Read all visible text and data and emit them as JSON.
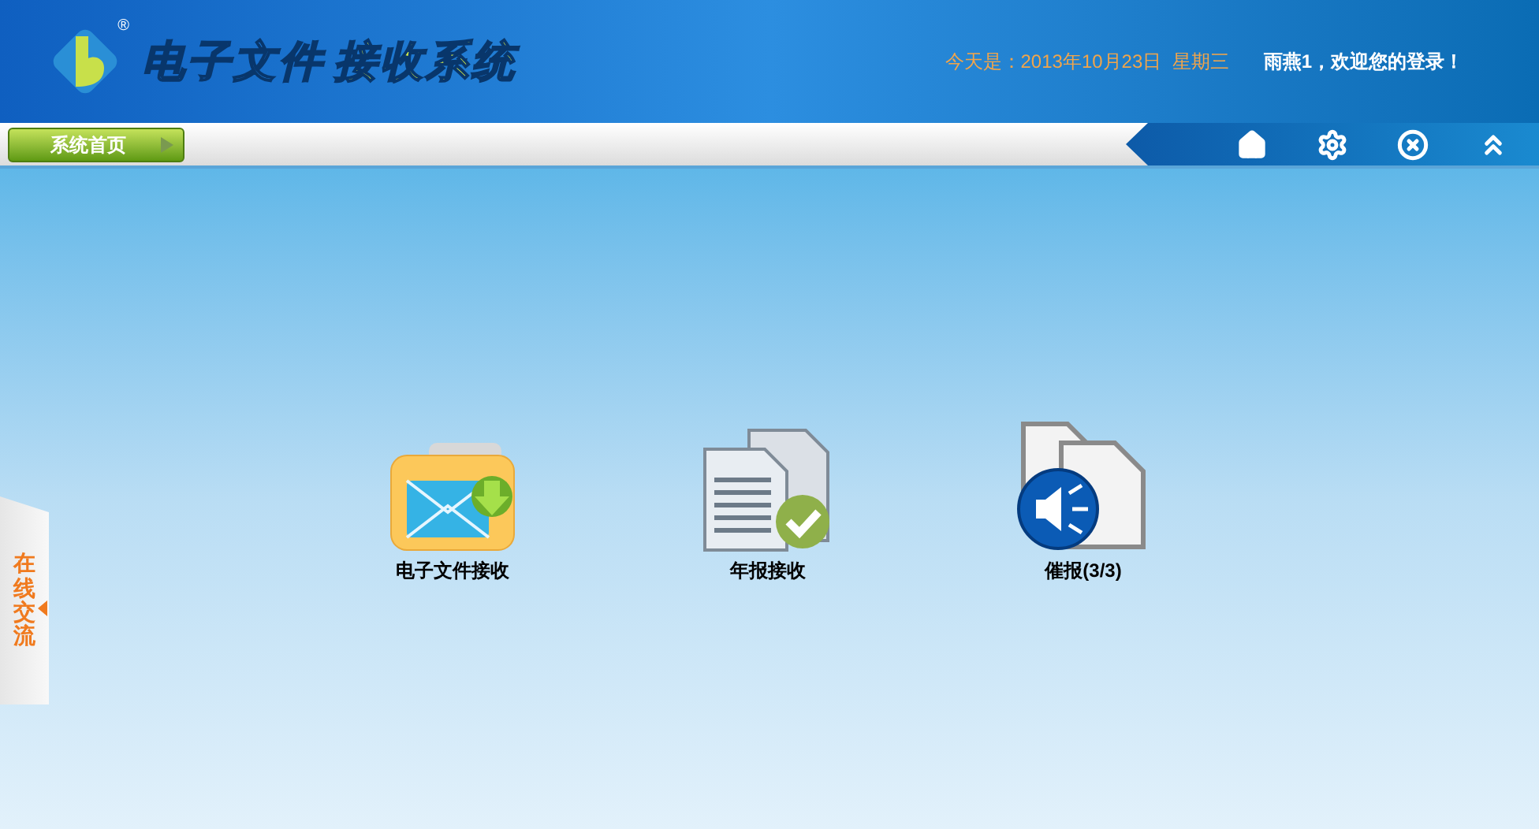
{
  "header": {
    "logo_mark": "®",
    "title_part1": "电子文件",
    "title_part2": "接收系统",
    "date": "今天是：2013年10月23日  星期三",
    "welcome": "雨燕1，欢迎您的登录！"
  },
  "nav": {
    "home_tab": "系统首页",
    "tools": [
      {
        "kind": "home"
      },
      {
        "kind": "settings"
      },
      {
        "kind": "close"
      },
      {
        "kind": "collapse"
      }
    ]
  },
  "apps": [
    {
      "kind": "folder",
      "label": "电子文件接收"
    },
    {
      "kind": "document",
      "label": "年报接收"
    },
    {
      "kind": "speaker",
      "label": "催报(3/3)"
    }
  ],
  "side_tab": {
    "label": "在线交流"
  }
}
